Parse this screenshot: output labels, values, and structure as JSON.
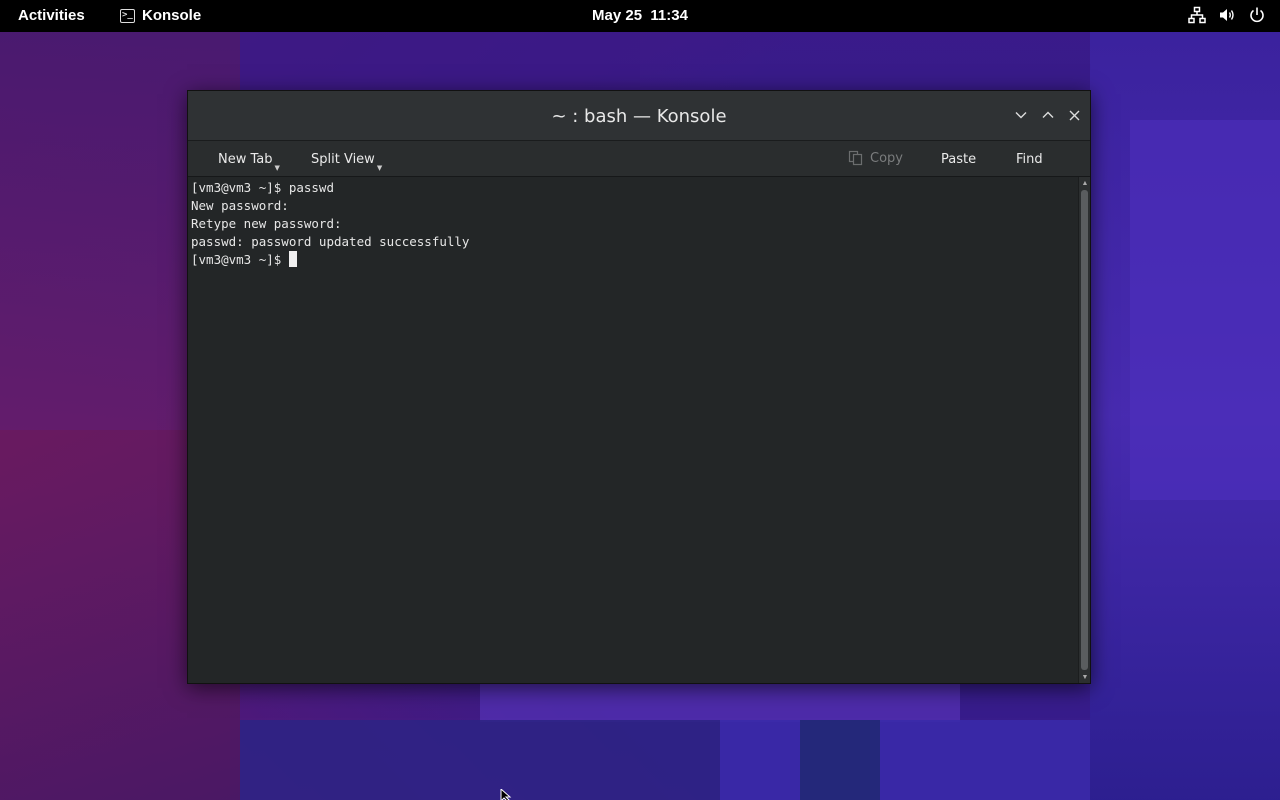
{
  "topbar": {
    "activities_label": "Activities",
    "app_name": "Konsole",
    "clock_date": "May 25",
    "clock_time": "11:34",
    "tray_icons": [
      "network-icon",
      "volume-icon",
      "power-icon"
    ]
  },
  "window": {
    "title": "~ : bash — Konsole",
    "controls": [
      "minimize-icon",
      "maximize-icon",
      "close-icon"
    ]
  },
  "toolbar": {
    "new_tab_label": "New Tab",
    "split_view_label": "Split View",
    "copy_label": "Copy",
    "paste_label": "Paste",
    "find_label": "Find"
  },
  "terminal": {
    "lines": [
      "[vm3@vm3 ~]$ passwd",
      "New password:",
      "Retype new password:",
      "passwd: password updated successfully"
    ],
    "prompt": "[vm3@vm3 ~]$ "
  },
  "colors": {
    "topbar_bg": "#000000",
    "terminal_bg": "#232627",
    "terminal_fg": "#e6e6e6",
    "titlebar_bg": "#2f3234"
  }
}
